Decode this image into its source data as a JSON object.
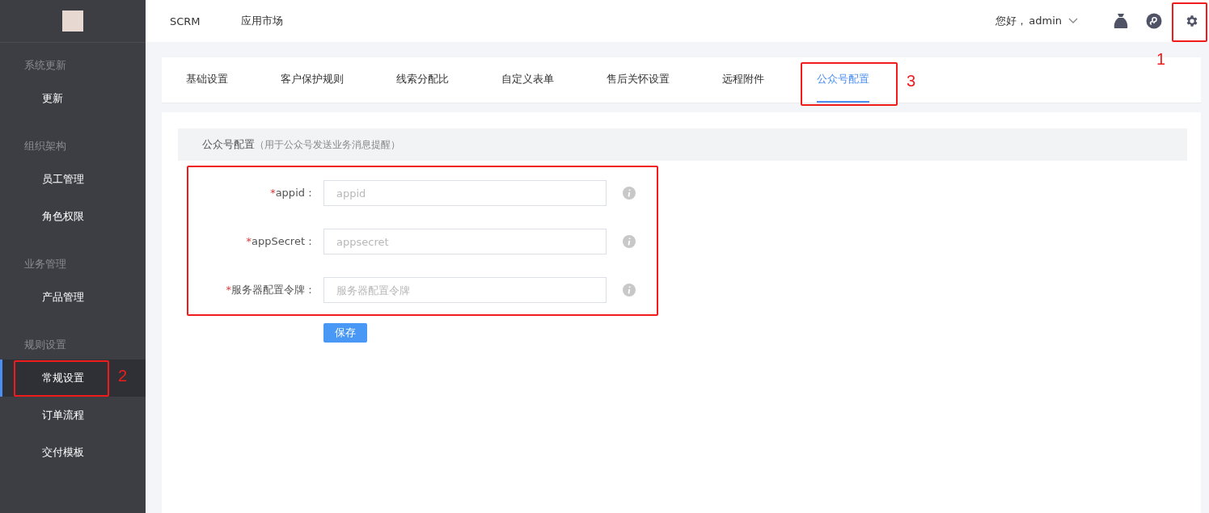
{
  "sidebar": {
    "groups": [
      {
        "title": "系统更新",
        "items": [
          {
            "label": "更新",
            "selected": false
          }
        ]
      },
      {
        "title": "组织架构",
        "items": [
          {
            "label": "员工管理",
            "selected": false
          },
          {
            "label": "角色权限",
            "selected": false
          }
        ]
      },
      {
        "title": "业务管理",
        "items": [
          {
            "label": "产品管理",
            "selected": false
          }
        ]
      },
      {
        "title": "规则设置",
        "items": [
          {
            "label": "常规设置",
            "selected": true
          },
          {
            "label": "订单流程",
            "selected": false
          },
          {
            "label": "交付模板",
            "selected": false
          }
        ]
      }
    ]
  },
  "topbar": {
    "nav": [
      "SCRM",
      "应用市场"
    ],
    "greeting": "您好，",
    "user": "admin"
  },
  "tabs": [
    {
      "label": "基础设置",
      "selected": false
    },
    {
      "label": "客户保护规则",
      "selected": false
    },
    {
      "label": "线索分配比",
      "selected": false
    },
    {
      "label": "自定义表单",
      "selected": false
    },
    {
      "label": "售后关怀设置",
      "selected": false
    },
    {
      "label": "远程附件",
      "selected": false
    },
    {
      "label": "公众号配置",
      "selected": true
    }
  ],
  "section": {
    "title": "公众号配置",
    "hint": "（用于公众号发送业务消息提醒）"
  },
  "fields": [
    {
      "required_mark": "*",
      "label": "appid：",
      "placeholder": "appid"
    },
    {
      "required_mark": "*",
      "label": "appSecret：",
      "placeholder": "appsecret"
    },
    {
      "required_mark": "*",
      "label": "服务器配置令牌：",
      "placeholder": "服务器配置令牌"
    }
  ],
  "save_button": "保存",
  "annotations": [
    {
      "label": "1"
    },
    {
      "label": "2"
    },
    {
      "label": "3"
    }
  ]
}
